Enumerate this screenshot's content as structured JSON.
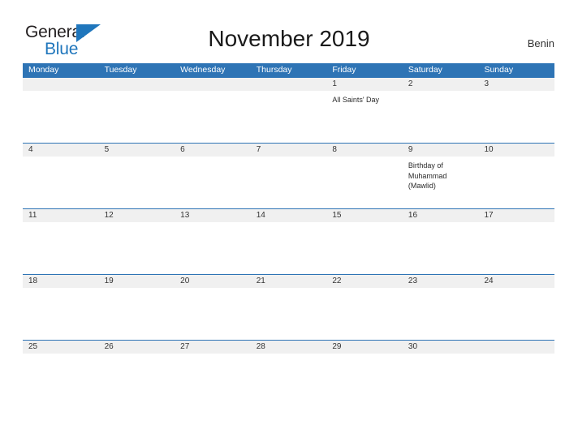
{
  "brand": {
    "name_part1": "General",
    "name_part2": "Blue",
    "logo_icon": "blue-flag-triangle-icon",
    "color_dark": "#231f20",
    "color_blue": "#1f76bc"
  },
  "header": {
    "title": "November 2019",
    "country": "Benin"
  },
  "theme": {
    "header_blue": "#2e74b5",
    "date_band_gray": "#f0f0f0",
    "text_color": "#333333",
    "background": "#ffffff"
  },
  "calendar": {
    "month": "November",
    "year": "2019",
    "weekday_headers": [
      "Monday",
      "Tuesday",
      "Wednesday",
      "Thursday",
      "Friday",
      "Saturday",
      "Sunday"
    ],
    "weeks": [
      {
        "days": [
          {
            "date": "",
            "events": ""
          },
          {
            "date": "",
            "events": ""
          },
          {
            "date": "",
            "events": ""
          },
          {
            "date": "",
            "events": ""
          },
          {
            "date": "1",
            "events": "All Saints' Day"
          },
          {
            "date": "2",
            "events": ""
          },
          {
            "date": "3",
            "events": ""
          }
        ]
      },
      {
        "days": [
          {
            "date": "4",
            "events": ""
          },
          {
            "date": "5",
            "events": ""
          },
          {
            "date": "6",
            "events": ""
          },
          {
            "date": "7",
            "events": ""
          },
          {
            "date": "8",
            "events": ""
          },
          {
            "date": "9",
            "events": "Birthday of Muhammad (Mawlid)"
          },
          {
            "date": "10",
            "events": ""
          }
        ]
      },
      {
        "days": [
          {
            "date": "11",
            "events": ""
          },
          {
            "date": "12",
            "events": ""
          },
          {
            "date": "13",
            "events": ""
          },
          {
            "date": "14",
            "events": ""
          },
          {
            "date": "15",
            "events": ""
          },
          {
            "date": "16",
            "events": ""
          },
          {
            "date": "17",
            "events": ""
          }
        ]
      },
      {
        "days": [
          {
            "date": "18",
            "events": ""
          },
          {
            "date": "19",
            "events": ""
          },
          {
            "date": "20",
            "events": ""
          },
          {
            "date": "21",
            "events": ""
          },
          {
            "date": "22",
            "events": ""
          },
          {
            "date": "23",
            "events": ""
          },
          {
            "date": "24",
            "events": ""
          }
        ]
      },
      {
        "days": [
          {
            "date": "25",
            "events": ""
          },
          {
            "date": "26",
            "events": ""
          },
          {
            "date": "27",
            "events": ""
          },
          {
            "date": "28",
            "events": ""
          },
          {
            "date": "29",
            "events": ""
          },
          {
            "date": "30",
            "events": ""
          },
          {
            "date": "",
            "events": ""
          }
        ]
      }
    ]
  }
}
